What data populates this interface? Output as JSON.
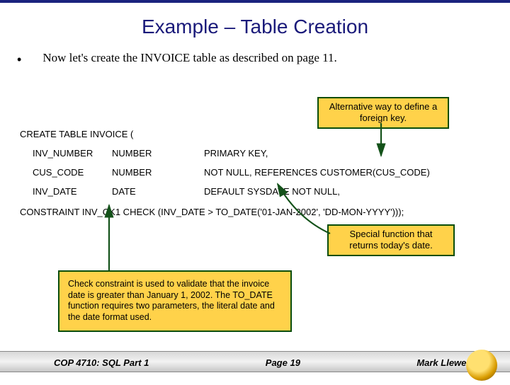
{
  "title": "Example – Table Creation",
  "bullet": "Now let's create the INVOICE table as described on page 11.",
  "callouts": {
    "fk": "Alternative way to define a foreign key.",
    "sysdate": "Special function that returns today's date.",
    "check": "Check constraint is used to validate that the invoice date is greater than January 1, 2002. The TO_DATE function requires two parameters, the literal date and the date format used."
  },
  "sql": {
    "create": "CREATE TABLE INVOICE (",
    "rows": [
      {
        "col": "INV_NUMBER",
        "type": "NUMBER",
        "rest": "PRIMARY KEY,"
      },
      {
        "col": "CUS_CODE",
        "type": "NUMBER",
        "rest": "NOT NULL, REFERENCES CUSTOMER(CUS_CODE)"
      },
      {
        "col": "INV_DATE",
        "type": "DATE",
        "rest": "DEFAULT SYSDATE NOT NULL,"
      }
    ],
    "constraint": "CONSTRAINT  INV_CK1  CHECK (INV_DATE > TO_DATE('01-JAN-2002', 'DD-MON-YYYY')));"
  },
  "footer": {
    "left": "COP 4710: SQL Part 1",
    "center": "Page 19",
    "right": "Mark Llewellyn ©"
  }
}
